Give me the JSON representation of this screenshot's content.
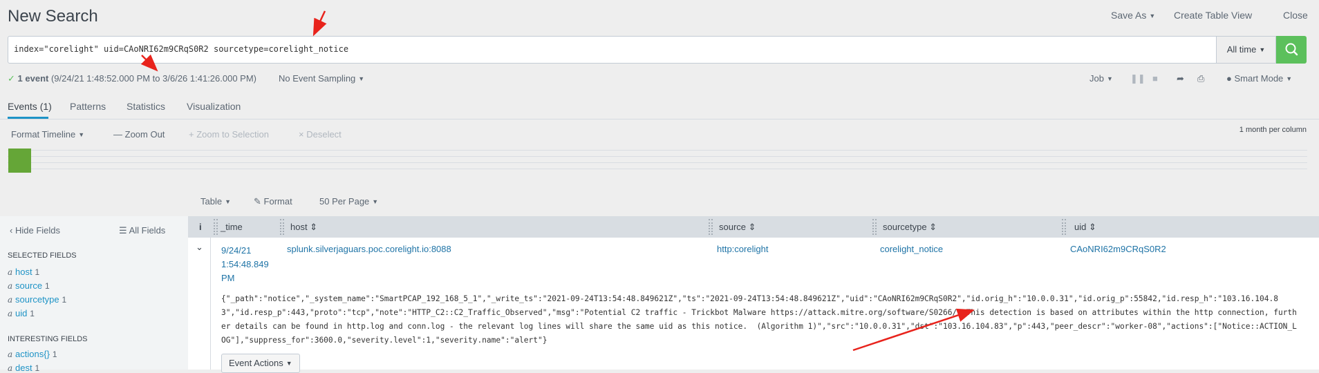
{
  "header": {
    "title": "New Search",
    "save_as": "Save As",
    "create_table_view": "Create Table View",
    "close": "Close"
  },
  "search": {
    "query": "index=\"corelight\" uid=CAoNRI62m9CRqS0R2 sourcetype=corelight_notice",
    "time_range": "All time"
  },
  "status": {
    "events": "1 event",
    "range": "(9/24/21 1:48:52.000 PM to 3/6/26 1:41:26.000 PM)",
    "sampling": "No Event Sampling",
    "job": "Job",
    "mode": "Smart Mode"
  },
  "tabs": [
    {
      "label": "Events (1)",
      "active": true
    },
    {
      "label": "Patterns",
      "active": false
    },
    {
      "label": "Statistics",
      "active": false
    },
    {
      "label": "Visualization",
      "active": false
    }
  ],
  "timeline": {
    "format": "Format Timeline",
    "zoom_out": "Zoom Out",
    "zoom_selection": "Zoom to Selection",
    "deselect": "Deselect",
    "scale": "1 month per column"
  },
  "results_controls": {
    "table": "Table",
    "format": "Format",
    "per_page": "50 Per Page"
  },
  "sidebar": {
    "hide_fields": "Hide Fields",
    "all_fields": "All Fields",
    "selected_heading": "SELECTED FIELDS",
    "selected": [
      {
        "type": "a",
        "name": "host",
        "count": "1"
      },
      {
        "type": "a",
        "name": "source",
        "count": "1"
      },
      {
        "type": "a",
        "name": "sourcetype",
        "count": "1"
      },
      {
        "type": "a",
        "name": "uid",
        "count": "1"
      }
    ],
    "interesting_heading": "INTERESTING FIELDS",
    "interesting": [
      {
        "type": "a",
        "name": "actions{}",
        "count": "1"
      },
      {
        "type": "a",
        "name": "dest",
        "count": "1"
      }
    ]
  },
  "grid": {
    "columns": [
      "i",
      "_time",
      "host",
      "source",
      "sourcetype",
      "uid"
    ],
    "row": {
      "time_1": "9/24/21",
      "time_2": "1:54:48.849",
      "time_3": "PM",
      "host": "splunk.silverjaguars.poc.corelight.io:8088",
      "source": "http:corelight",
      "sourcetype": "corelight_notice",
      "uid": "CAoNRI62m9CRqS0R2"
    },
    "raw": "{\"_path\":\"notice\",\"_system_name\":\"SmartPCAP_192_168_5_1\",\"_write_ts\":\"2021-09-24T13:54:48.849621Z\",\"ts\":\"2021-09-24T13:54:48.849621Z\",\"uid\":\"CAoNRI62m9CRqS0R2\",\"id.orig_h\":\"10.0.0.31\",\"id.orig_p\":55842,\"id.resp_h\":\"103.16.104.83\",\"id.resp_p\":443,\"proto\":\"tcp\",\"note\":\"HTTP_C2::C2_Traffic_Observed\",\"msg\":\"Potential C2 traffic - Trickbot Malware https://attack.mitre.org/software/S0266/. This detection is based on attributes within the http connection, further details can be found in http.log and conn.log - the relevant log lines will share the same uid as this notice.  (Algorithm 1)\",\"src\":\"10.0.0.31\",\"dst\":\"103.16.104.83\",\"p\":443,\"peer_descr\":\"worker-08\",\"actions\":[\"Notice::ACTION_LOG\"],\"suppress_for\":3600.0,\"severity.level\":1,\"severity.name\":\"alert\"}",
    "event_actions": "Event Actions"
  },
  "colors": {
    "accent": "#1e93c6",
    "search_button": "#5cc05c",
    "timeline_bar": "#65a637",
    "annotation": "#e8231c"
  }
}
